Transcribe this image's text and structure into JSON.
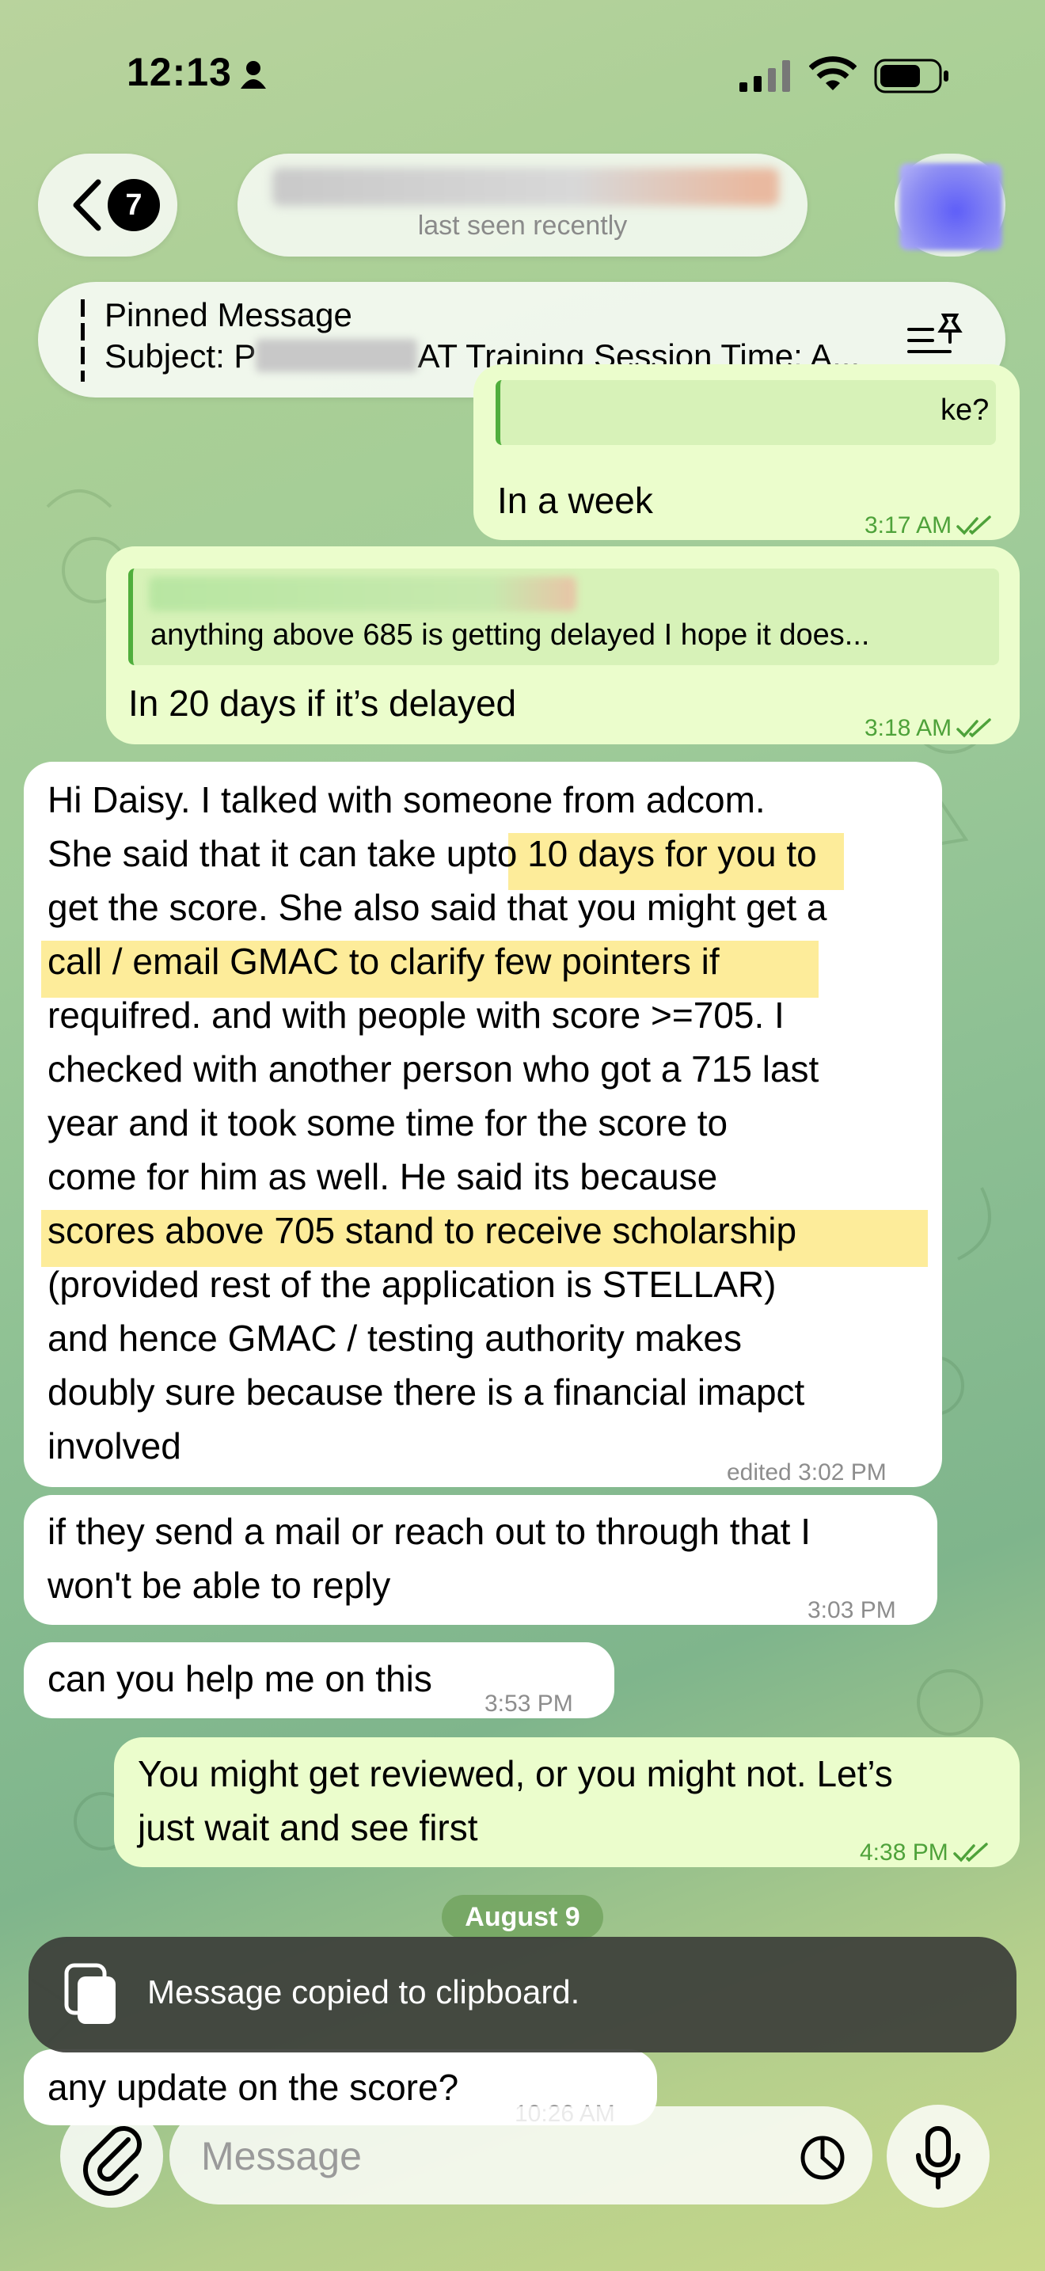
{
  "status_bar": {
    "time": "12:13"
  },
  "header": {
    "back_count": "7",
    "contact_status": "last seen recently"
  },
  "pinned": {
    "title": "Pinned Message",
    "text_start": "Subject: P",
    "text_end": "AT Training Session Time: A..."
  },
  "messages": [
    {
      "id": "m1",
      "direction": "out",
      "reply_text": "ke?",
      "text": "In a week",
      "time": "3:17 AM",
      "read": true
    },
    {
      "id": "m2",
      "direction": "out",
      "reply_text": "anything above 685 is getting delayed I hope it does...",
      "text": "In 20 days if it’s delayed",
      "time": "3:18 AM",
      "read": true
    },
    {
      "id": "m3",
      "direction": "in",
      "lines": [
        "Hi Daisy. I talked with someone from adcom.",
        "She said that it can take upto 10 days for you to",
        "get the score. She also said that you might get a",
        "call / email GMAC to clarify few pointers if",
        "requifred.  and with people with score >=705. I",
        "checked with another person who got a 715 last",
        "year and it took some time for the score to",
        "come for him as well. He said its because",
        "scores above 705 stand to receive scholarship",
        "(provided rest of the application is STELLAR)",
        "and hence GMAC / testing authority makes",
        "doubly sure because there is a financial imapct",
        "involved"
      ],
      "time": "edited 3:02 PM"
    },
    {
      "id": "m4",
      "direction": "in",
      "lines": [
        "if they send a mail or reach out to through that I",
        "won't be able to reply"
      ],
      "time": "3:03 PM"
    },
    {
      "id": "m5",
      "direction": "in",
      "text": "can you help me on this",
      "time": "3:53 PM"
    },
    {
      "id": "m6",
      "direction": "out",
      "lines": [
        "You might get reviewed, or you might not. Let’s",
        "just wait and see first"
      ],
      "time": "4:38 PM",
      "read": true
    },
    {
      "id": "m7",
      "direction": "in",
      "text": "any update on the score?",
      "time": "10:26 AM"
    }
  ],
  "date_separator": "August 9",
  "toast": {
    "text": "Message copied to clipboard."
  },
  "input": {
    "placeholder": "Message"
  },
  "colors": {
    "outgoing_bubble": "#ebfdcc",
    "incoming_bubble": "#ffffff",
    "read_ticks": "#4ea23a",
    "highlight": "#fce578"
  }
}
